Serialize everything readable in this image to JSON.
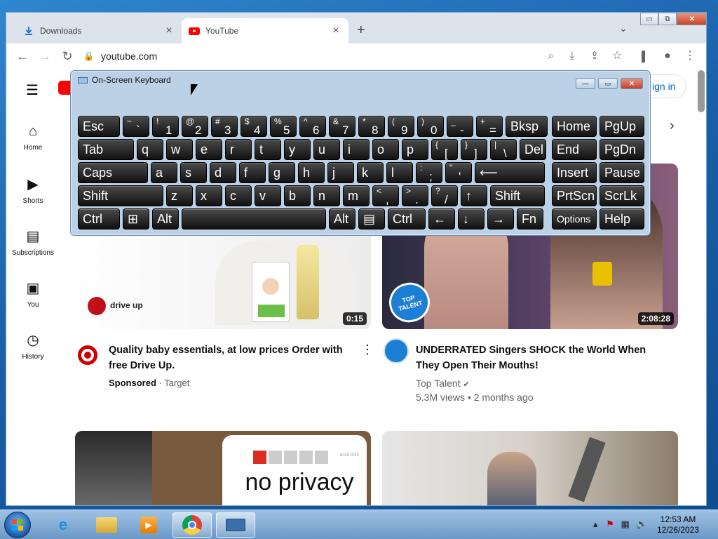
{
  "browser": {
    "tabs": [
      {
        "label": "Downloads",
        "icon": "download-icon",
        "active": false
      },
      {
        "label": "YouTube",
        "icon": "youtube-icon",
        "active": true
      }
    ],
    "new_tab": "+",
    "url": "youtube.com",
    "window_controls": {
      "minimize": "▭",
      "restore": "⧉",
      "close": "✕"
    }
  },
  "youtube": {
    "signin_label": "ign in",
    "sidebar": [
      {
        "label": "Home",
        "icon": "home-icon"
      },
      {
        "label": "Shorts",
        "icon": "shorts-icon"
      },
      {
        "label": "Subscriptions",
        "icon": "subscriptions-icon"
      },
      {
        "label": "You",
        "icon": "you-icon"
      },
      {
        "label": "History",
        "icon": "history-icon"
      }
    ],
    "videos": [
      {
        "title_line1": "Quality baby essentials, at low prices Order with",
        "title_line2": "free Drive Up.",
        "channel": "Sponsored",
        "channel_suffix": "· Target",
        "meta": "",
        "duration": "0:15",
        "brand_text": "drive up"
      },
      {
        "title_line1": "UNDERRATED Singers SHOCK the World When",
        "title_line2": "They Open Their Mouths!",
        "channel": "Top Talent",
        "channel_suffix": "",
        "meta": "5.3M views • 2 months ago",
        "duration": "2:08:28",
        "badge_text": "TOP TALENT"
      },
      {
        "title_line1": "",
        "title_line2": "",
        "channel": "",
        "thumb_text": "no privacy",
        "thumb_date": "6/23/2023"
      },
      {
        "title_line1": "",
        "title_line2": "",
        "channel": ""
      }
    ]
  },
  "osk": {
    "title": "On-Screen Keyboard",
    "rows": [
      [
        {
          "t": "Esc"
        },
        {
          "s": "~",
          "m": "`"
        },
        {
          "s": "!",
          "m": "1"
        },
        {
          "s": "@",
          "m": "2"
        },
        {
          "s": "#",
          "m": "3"
        },
        {
          "s": "$",
          "m": "4"
        },
        {
          "s": "%",
          "m": "5"
        },
        {
          "s": "^",
          "m": "6"
        },
        {
          "s": "&",
          "m": "7"
        },
        {
          "s": "*",
          "m": "8"
        },
        {
          "s": "(",
          "m": "9"
        },
        {
          "s": ")",
          "m": "0"
        },
        {
          "s": "_",
          "m": "-"
        },
        {
          "s": "+",
          "m": "="
        },
        {
          "t": "Bksp"
        },
        {
          "t": "Home"
        },
        {
          "t": "PgUp"
        }
      ],
      [
        {
          "t": "Tab"
        },
        {
          "t": "q"
        },
        {
          "t": "w"
        },
        {
          "t": "e"
        },
        {
          "t": "r"
        },
        {
          "t": "t"
        },
        {
          "t": "y"
        },
        {
          "t": "u"
        },
        {
          "t": "i"
        },
        {
          "t": "o"
        },
        {
          "t": "p"
        },
        {
          "s": "{",
          "m": "["
        },
        {
          "s": "}",
          "m": "]"
        },
        {
          "s": "|",
          "m": "\\"
        },
        {
          "t": "Del"
        },
        {
          "t": "End"
        },
        {
          "t": "PgDn"
        }
      ],
      [
        {
          "t": "Caps"
        },
        {
          "t": "a"
        },
        {
          "t": "s"
        },
        {
          "t": "d"
        },
        {
          "t": "f"
        },
        {
          "t": "g"
        },
        {
          "t": "h"
        },
        {
          "t": "j"
        },
        {
          "t": "k"
        },
        {
          "t": "l"
        },
        {
          "s": ":",
          "m": ";"
        },
        {
          "s": "\"",
          "m": "'"
        },
        {
          "t": "⟵"
        },
        {
          "t": "Insert"
        },
        {
          "t": "Pause"
        }
      ],
      [
        {
          "t": "Shift"
        },
        {
          "t": "z"
        },
        {
          "t": "x"
        },
        {
          "t": "c"
        },
        {
          "t": "v"
        },
        {
          "t": "b"
        },
        {
          "t": "n"
        },
        {
          "t": "m"
        },
        {
          "s": "<",
          "m": ","
        },
        {
          "s": ">",
          "m": "."
        },
        {
          "s": "?",
          "m": "/"
        },
        {
          "t": "↑"
        },
        {
          "t": "Shift"
        },
        {
          "t": "PrtScn"
        },
        {
          "t": "ScrLk"
        }
      ],
      [
        {
          "t": "Ctrl"
        },
        {
          "t": "⊞"
        },
        {
          "t": "Alt"
        },
        {
          "t": ""
        },
        {
          "t": "Alt"
        },
        {
          "t": "▤"
        },
        {
          "t": "Ctrl"
        },
        {
          "t": "←"
        },
        {
          "t": "↓"
        },
        {
          "t": "→"
        },
        {
          "t": "Fn"
        },
        {
          "t": "Options"
        },
        {
          "t": "Help"
        }
      ]
    ]
  },
  "taskbar": {
    "time": "12:53 AM",
    "date": "12/26/2023",
    "apps": [
      "ie-icon",
      "explorer-icon",
      "media-player-icon",
      "chrome-icon",
      "osk-icon"
    ]
  }
}
